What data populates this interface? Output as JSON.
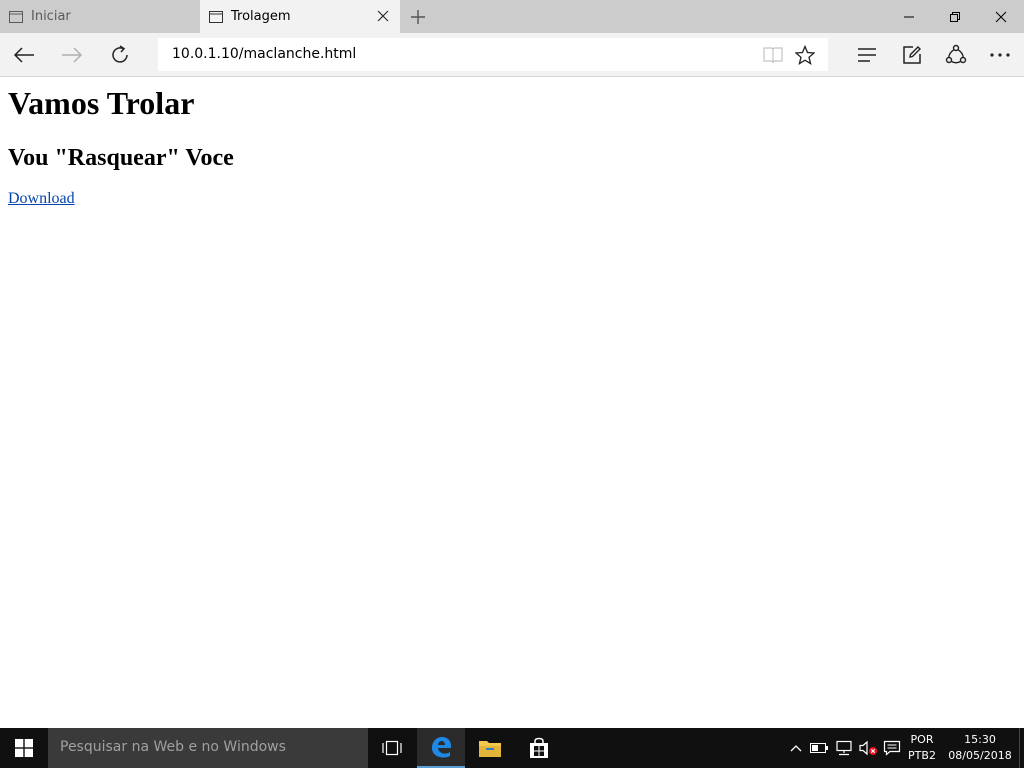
{
  "tabs": [
    {
      "label": "Iniciar",
      "active": false
    },
    {
      "label": "Trolagem",
      "active": true
    }
  ],
  "toolbar": {
    "address": "10.0.1.10/maclanche.html"
  },
  "page": {
    "heading1": "Vamos Trolar",
    "heading2": "Vou \"Rasquear\" Voce",
    "link": "Download"
  },
  "taskbar": {
    "search_placeholder": "Pesquisar na Web e no Windows",
    "language": {
      "line1": "POR",
      "line2": "PTB2"
    },
    "clock": {
      "time": "15:30",
      "date": "08/05/2018"
    }
  },
  "colors": {
    "tabstrip": "#cccccc",
    "toolbar": "#f2f2f2",
    "taskbar": "#101010",
    "link": "#0645ad",
    "edge_blue": "#1e88e5"
  },
  "icons": {
    "tab_icon": "tab-page-icon",
    "back": "back-arrow-icon",
    "forward": "forward-arrow-icon",
    "refresh": "refresh-icon",
    "reading_view": "reading-view-icon",
    "favorite": "star-icon",
    "hub": "hub-icon",
    "note": "web-note-icon",
    "share": "share-icon",
    "more": "more-icon"
  }
}
